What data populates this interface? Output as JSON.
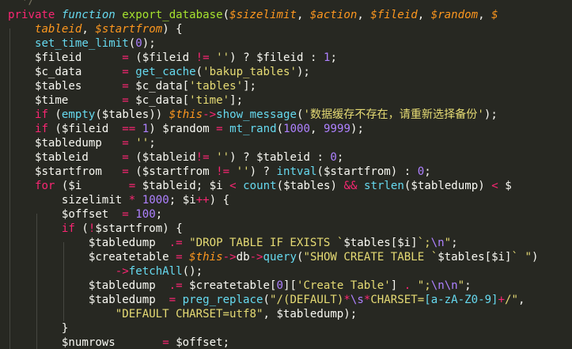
{
  "editor": {
    "theme": {
      "background": "#272822",
      "foreground": "#f8f8f2",
      "keyword": "#f92672",
      "storage": "#66d9ef",
      "function": "#a6e22e",
      "parameter": "#fd971f",
      "string": "#e6db74",
      "number": "#ae81ff",
      "comment": "#75715e"
    },
    "lines": [
      [
        [
          "c-comment",
          "  */"
        ]
      ],
      [
        [
          "c-kw",
          "private"
        ],
        [
          "c-punc",
          " "
        ],
        [
          "c-storage",
          "function"
        ],
        [
          "c-punc",
          " "
        ],
        [
          "c-fn",
          "export_database"
        ],
        [
          "c-punc",
          "("
        ],
        [
          "c-param",
          "$sizelimit"
        ],
        [
          "c-punc",
          ", "
        ],
        [
          "c-param",
          "$action"
        ],
        [
          "c-punc",
          ", "
        ],
        [
          "c-param",
          "$fileid"
        ],
        [
          "c-punc",
          ", "
        ],
        [
          "c-param",
          "$random"
        ],
        [
          "c-punc",
          ", "
        ],
        [
          "c-param",
          "$"
        ]
      ],
      [
        [
          "c-punc",
          "    "
        ],
        [
          "c-param",
          "tableid"
        ],
        [
          "c-punc",
          ", "
        ],
        [
          "c-param",
          "$startfrom"
        ],
        [
          "c-punc",
          ") {"
        ]
      ],
      [
        [
          "c-punc",
          "    "
        ],
        [
          "c-builtin",
          "set_time_limit"
        ],
        [
          "c-punc",
          "("
        ],
        [
          "c-num",
          "0"
        ],
        [
          "c-punc",
          ");"
        ]
      ],
      [
        [
          "c-punc",
          "    "
        ],
        [
          "c-var",
          "$fileid      "
        ],
        [
          "c-op",
          "="
        ],
        [
          "c-punc",
          " ("
        ],
        [
          "c-var",
          "$fileid "
        ],
        [
          "c-op",
          "!="
        ],
        [
          "c-punc",
          " "
        ],
        [
          "c-str",
          "''"
        ],
        [
          "c-punc",
          ") ? "
        ],
        [
          "c-var",
          "$fileid"
        ],
        [
          "c-punc",
          " : "
        ],
        [
          "c-num",
          "1"
        ],
        [
          "c-punc",
          ";"
        ]
      ],
      [
        [
          "c-punc",
          "    "
        ],
        [
          "c-var",
          "$c_data      "
        ],
        [
          "c-op",
          "="
        ],
        [
          "c-punc",
          " "
        ],
        [
          "c-builtin",
          "get_cache"
        ],
        [
          "c-punc",
          "("
        ],
        [
          "c-str",
          "'bakup_tables'"
        ],
        [
          "c-punc",
          ");"
        ]
      ],
      [
        [
          "c-punc",
          "    "
        ],
        [
          "c-var",
          "$tables      "
        ],
        [
          "c-op",
          "="
        ],
        [
          "c-punc",
          " "
        ],
        [
          "c-var",
          "$c_data"
        ],
        [
          "c-punc",
          "["
        ],
        [
          "c-str",
          "'tables'"
        ],
        [
          "c-punc",
          "];"
        ]
      ],
      [
        [
          "c-punc",
          "    "
        ],
        [
          "c-var",
          "$time        "
        ],
        [
          "c-op",
          "="
        ],
        [
          "c-punc",
          " "
        ],
        [
          "c-var",
          "$c_data"
        ],
        [
          "c-punc",
          "["
        ],
        [
          "c-str",
          "'time'"
        ],
        [
          "c-punc",
          "];"
        ]
      ],
      [
        [
          "c-punc",
          "    "
        ],
        [
          "c-kw",
          "if"
        ],
        [
          "c-punc",
          " ("
        ],
        [
          "c-builtin",
          "empty"
        ],
        [
          "c-punc",
          "("
        ],
        [
          "c-var",
          "$tables"
        ],
        [
          "c-punc",
          ")) "
        ],
        [
          "c-this",
          "$this"
        ],
        [
          "c-op",
          "->"
        ],
        [
          "c-builtin",
          "show_message"
        ],
        [
          "c-punc",
          "("
        ],
        [
          "c-str",
          "'数据缓存不存在，请重新选择备份'"
        ],
        [
          "c-punc",
          ");"
        ]
      ],
      [
        [
          "c-punc",
          "    "
        ],
        [
          "c-kw",
          "if"
        ],
        [
          "c-punc",
          " ("
        ],
        [
          "c-var",
          "$fileid  "
        ],
        [
          "c-op",
          "=="
        ],
        [
          "c-punc",
          " "
        ],
        [
          "c-num",
          "1"
        ],
        [
          "c-punc",
          ") "
        ],
        [
          "c-var",
          "$random"
        ],
        [
          "c-punc",
          " "
        ],
        [
          "c-op",
          "="
        ],
        [
          "c-punc",
          " "
        ],
        [
          "c-builtin",
          "mt_rand"
        ],
        [
          "c-punc",
          "("
        ],
        [
          "c-num",
          "1000"
        ],
        [
          "c-punc",
          ", "
        ],
        [
          "c-num",
          "9999"
        ],
        [
          "c-punc",
          ");"
        ]
      ],
      [
        [
          "c-punc",
          "    "
        ],
        [
          "c-var",
          "$tabledump   "
        ],
        [
          "c-op",
          "="
        ],
        [
          "c-punc",
          " "
        ],
        [
          "c-str",
          "''"
        ],
        [
          "c-punc",
          ";"
        ]
      ],
      [
        [
          "c-punc",
          "    "
        ],
        [
          "c-var",
          "$tableid     "
        ],
        [
          "c-op",
          "="
        ],
        [
          "c-punc",
          " ("
        ],
        [
          "c-var",
          "$tableid"
        ],
        [
          "c-op",
          "!="
        ],
        [
          "c-punc",
          " "
        ],
        [
          "c-str",
          "''"
        ],
        [
          "c-punc",
          ") ? "
        ],
        [
          "c-var",
          "$tableid"
        ],
        [
          "c-punc",
          " : "
        ],
        [
          "c-num",
          "0"
        ],
        [
          "c-punc",
          ";"
        ]
      ],
      [
        [
          "c-punc",
          "    "
        ],
        [
          "c-var",
          "$startfrom   "
        ],
        [
          "c-op",
          "="
        ],
        [
          "c-punc",
          " ("
        ],
        [
          "c-var",
          "$startfrom "
        ],
        [
          "c-op",
          "!="
        ],
        [
          "c-punc",
          " "
        ],
        [
          "c-str",
          "''"
        ],
        [
          "c-punc",
          ") ? "
        ],
        [
          "c-builtin",
          "intval"
        ],
        [
          "c-punc",
          "("
        ],
        [
          "c-var",
          "$startfrom"
        ],
        [
          "c-punc",
          ") : "
        ],
        [
          "c-num",
          "0"
        ],
        [
          "c-punc",
          ";"
        ]
      ],
      [
        [
          "c-punc",
          "    "
        ],
        [
          "c-kw",
          "for"
        ],
        [
          "c-punc",
          " ("
        ],
        [
          "c-var",
          "$i"
        ],
        [
          "c-punc",
          "       "
        ],
        [
          "c-op",
          "="
        ],
        [
          "c-punc",
          " "
        ],
        [
          "c-var",
          "$tableid"
        ],
        [
          "c-punc",
          "; "
        ],
        [
          "c-var",
          "$i"
        ],
        [
          "c-punc",
          " "
        ],
        [
          "c-op",
          "<"
        ],
        [
          "c-punc",
          " "
        ],
        [
          "c-builtin",
          "count"
        ],
        [
          "c-punc",
          "("
        ],
        [
          "c-var",
          "$tables"
        ],
        [
          "c-punc",
          ") "
        ],
        [
          "c-op",
          "&&"
        ],
        [
          "c-punc",
          " "
        ],
        [
          "c-builtin",
          "strlen"
        ],
        [
          "c-punc",
          "("
        ],
        [
          "c-var",
          "$tabledump"
        ],
        [
          "c-punc",
          ") "
        ],
        [
          "c-op",
          "<"
        ],
        [
          "c-punc",
          " $"
        ]
      ],
      [
        [
          "c-punc",
          "        "
        ],
        [
          "c-var",
          "sizelimit"
        ],
        [
          "c-punc",
          " "
        ],
        [
          "c-op",
          "*"
        ],
        [
          "c-punc",
          " "
        ],
        [
          "c-num",
          "1000"
        ],
        [
          "c-punc",
          "; "
        ],
        [
          "c-var",
          "$i"
        ],
        [
          "c-op",
          "++"
        ],
        [
          "c-punc",
          ") {"
        ]
      ],
      [
        [
          "c-punc",
          "        "
        ],
        [
          "c-var",
          "$offset"
        ],
        [
          "c-punc",
          "  "
        ],
        [
          "c-op",
          "="
        ],
        [
          "c-punc",
          " "
        ],
        [
          "c-num",
          "100"
        ],
        [
          "c-punc",
          ";"
        ]
      ],
      [
        [
          "c-punc",
          "        "
        ],
        [
          "c-kw",
          "if"
        ],
        [
          "c-punc",
          " ("
        ],
        [
          "c-op",
          "!"
        ],
        [
          "c-var",
          "$startfrom"
        ],
        [
          "c-punc",
          ") {"
        ]
      ],
      [
        [
          "c-punc",
          "            "
        ],
        [
          "c-var",
          "$tabledump  "
        ],
        [
          "c-op",
          ".="
        ],
        [
          "c-punc",
          " "
        ],
        [
          "c-str",
          "\"DROP TABLE IF EXISTS `"
        ],
        [
          "c-var",
          "$tables[$i]"
        ],
        [
          "c-str",
          "`;"
        ],
        [
          "c-esc",
          "\\n"
        ],
        [
          "c-str",
          "\""
        ],
        [
          "c-punc",
          ";"
        ]
      ],
      [
        [
          "c-punc",
          "            "
        ],
        [
          "c-var",
          "$createtable"
        ],
        [
          "c-punc",
          " "
        ],
        [
          "c-op",
          "="
        ],
        [
          "c-punc",
          " "
        ],
        [
          "c-this",
          "$this"
        ],
        [
          "c-op",
          "->"
        ],
        [
          "c-var",
          "db"
        ],
        [
          "c-op",
          "->"
        ],
        [
          "c-builtin",
          "query"
        ],
        [
          "c-punc",
          "("
        ],
        [
          "c-str",
          "\"SHOW CREATE TABLE `"
        ],
        [
          "c-var",
          "$tables[$i]"
        ],
        [
          "c-str",
          "` \""
        ],
        [
          "c-punc",
          ")"
        ]
      ],
      [
        [
          "c-punc",
          "                "
        ],
        [
          "c-op",
          "->"
        ],
        [
          "c-builtin",
          "fetchAll"
        ],
        [
          "c-punc",
          "();"
        ]
      ],
      [
        [
          "c-punc",
          "            "
        ],
        [
          "c-var",
          "$tabledump  "
        ],
        [
          "c-op",
          ".="
        ],
        [
          "c-punc",
          " "
        ],
        [
          "c-var",
          "$createtable"
        ],
        [
          "c-punc",
          "["
        ],
        [
          "c-num",
          "0"
        ],
        [
          "c-punc",
          "]["
        ],
        [
          "c-str",
          "'Create Table'"
        ],
        [
          "c-punc",
          "] "
        ],
        [
          "c-op",
          "."
        ],
        [
          "c-punc",
          " "
        ],
        [
          "c-str",
          "\";"
        ],
        [
          "c-esc",
          "\\n\\n"
        ],
        [
          "c-str",
          "\""
        ],
        [
          "c-punc",
          ";"
        ]
      ],
      [
        [
          "c-punc",
          "            "
        ],
        [
          "c-var",
          "$tabledump  "
        ],
        [
          "c-op",
          "="
        ],
        [
          "c-punc",
          " "
        ],
        [
          "c-builtin",
          "preg_replace"
        ],
        [
          "c-punc",
          "("
        ],
        [
          "c-str",
          "\"/(DEFAULT)"
        ],
        [
          "c-op",
          "*"
        ],
        [
          "c-esc",
          "\\s"
        ],
        [
          "c-op",
          "*"
        ],
        [
          "c-str",
          "CHARSET="
        ],
        [
          "c-rx",
          "[a-zA-Z0-9]"
        ],
        [
          "c-op",
          "+"
        ],
        [
          "c-str",
          "/\""
        ],
        [
          "c-punc",
          ","
        ]
      ],
      [
        [
          "c-punc",
          "                "
        ],
        [
          "c-str",
          "\"DEFAULT CHARSET=utf8\""
        ],
        [
          "c-punc",
          ", "
        ],
        [
          "c-var",
          "$tabledump"
        ],
        [
          "c-punc",
          ");"
        ]
      ],
      [
        [
          "c-punc",
          "        }"
        ]
      ],
      [
        [
          "c-punc",
          "        "
        ],
        [
          "c-var",
          "$numrows"
        ],
        [
          "c-punc",
          "       "
        ],
        [
          "c-op",
          "="
        ],
        [
          "c-punc",
          " "
        ],
        [
          "c-var",
          "$offset"
        ],
        [
          "c-punc",
          ";"
        ]
      ]
    ]
  }
}
